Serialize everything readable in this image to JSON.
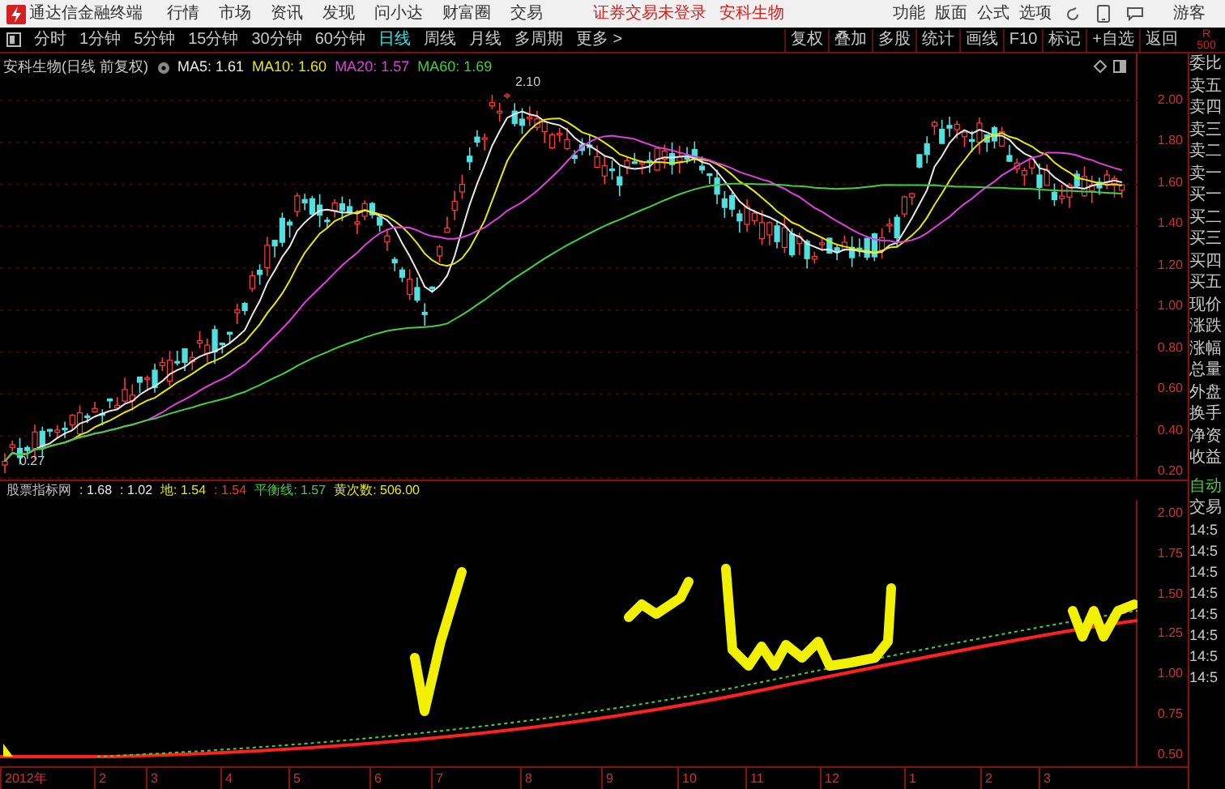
{
  "title_bar": {
    "app_name": "通达信金融终端",
    "menu": [
      "行情",
      "市场",
      "资讯",
      "发现",
      "问小达",
      "财富圈",
      "交易"
    ],
    "notices": [
      "证券交易未登录",
      "安科生物"
    ],
    "right_menu": [
      "功能",
      "版面",
      "公式",
      "选项"
    ],
    "user": "游客"
  },
  "toolbar": {
    "periods": [
      {
        "label": "分时",
        "selected": false
      },
      {
        "label": "1分钟",
        "selected": false
      },
      {
        "label": "5分钟",
        "selected": false
      },
      {
        "label": "15分钟",
        "selected": false
      },
      {
        "label": "30分钟",
        "selected": false
      },
      {
        "label": "60分钟",
        "selected": false
      },
      {
        "label": "日线",
        "selected": true
      },
      {
        "label": "周线",
        "selected": false
      },
      {
        "label": "月线",
        "selected": false
      },
      {
        "label": "多周期",
        "selected": false
      },
      {
        "label": "更多 >",
        "selected": false
      }
    ],
    "tools": [
      "复权",
      "叠加",
      "多股",
      "统计",
      "画线",
      "F10",
      "标记",
      "+自选",
      "返回"
    ],
    "panel_badge": [
      "R",
      "500"
    ]
  },
  "price_chart": {
    "title": "安科生物(日线 前复权)",
    "averages": [
      {
        "label": "MA5: 1.61",
        "color": "#e8e8e8"
      },
      {
        "label": "MA10: 1.60",
        "color": "#e8e800"
      },
      {
        "label": "MA20: 1.57",
        "color": "#e040e0"
      },
      {
        "label": "MA60: 1.69",
        "color": "#40d040"
      }
    ],
    "high_label": "2.10",
    "low_label": "0.27",
    "yticks": [
      "2.00",
      "1.80",
      "1.60",
      "1.40",
      "1.20",
      "1.00",
      "0.80",
      "0.60",
      "0.40",
      "0.20"
    ]
  },
  "indicator": {
    "items": [
      {
        "label": "股票指标网",
        "color": "#c0c0c0"
      },
      {
        "label": ": 1.68",
        "color": "#e8e8e8"
      },
      {
        "label": ": 1.02",
        "color": "#e8e8e8"
      },
      {
        "label": "地: 1.54",
        "color": "#e8e800"
      },
      {
        "label": ": 1.54",
        "color": "#ff3030"
      },
      {
        "label": "平衡线: 1.57",
        "color": "#40d040"
      },
      {
        "label": "黄次数: 506.00",
        "color": "#e8e800"
      }
    ],
    "yticks": [
      "2.00",
      "1.75",
      "1.50",
      "1.25",
      "1.00",
      "0.75",
      "0.50"
    ]
  },
  "x_axis": [
    "2012年",
    "2",
    "3",
    "4",
    "5",
    "6",
    "7",
    "8",
    "9",
    "10",
    "11",
    "12",
    "1",
    "2",
    "3"
  ],
  "quote_panel": {
    "labels": [
      "委比",
      "卖五",
      "卖四",
      "卖三",
      "卖二",
      "卖一",
      "买一",
      "买二",
      "买三",
      "买四",
      "买五",
      "现价",
      "涨跌",
      "涨幅",
      "总量",
      "外盘",
      "换手",
      "净资",
      "收益"
    ],
    "auto": "自动",
    "trade": "交易",
    "times": [
      "14:5",
      "14:5",
      "14:5",
      "14:5",
      "14:5",
      "14:5",
      "14:5",
      "14:5"
    ]
  }
}
